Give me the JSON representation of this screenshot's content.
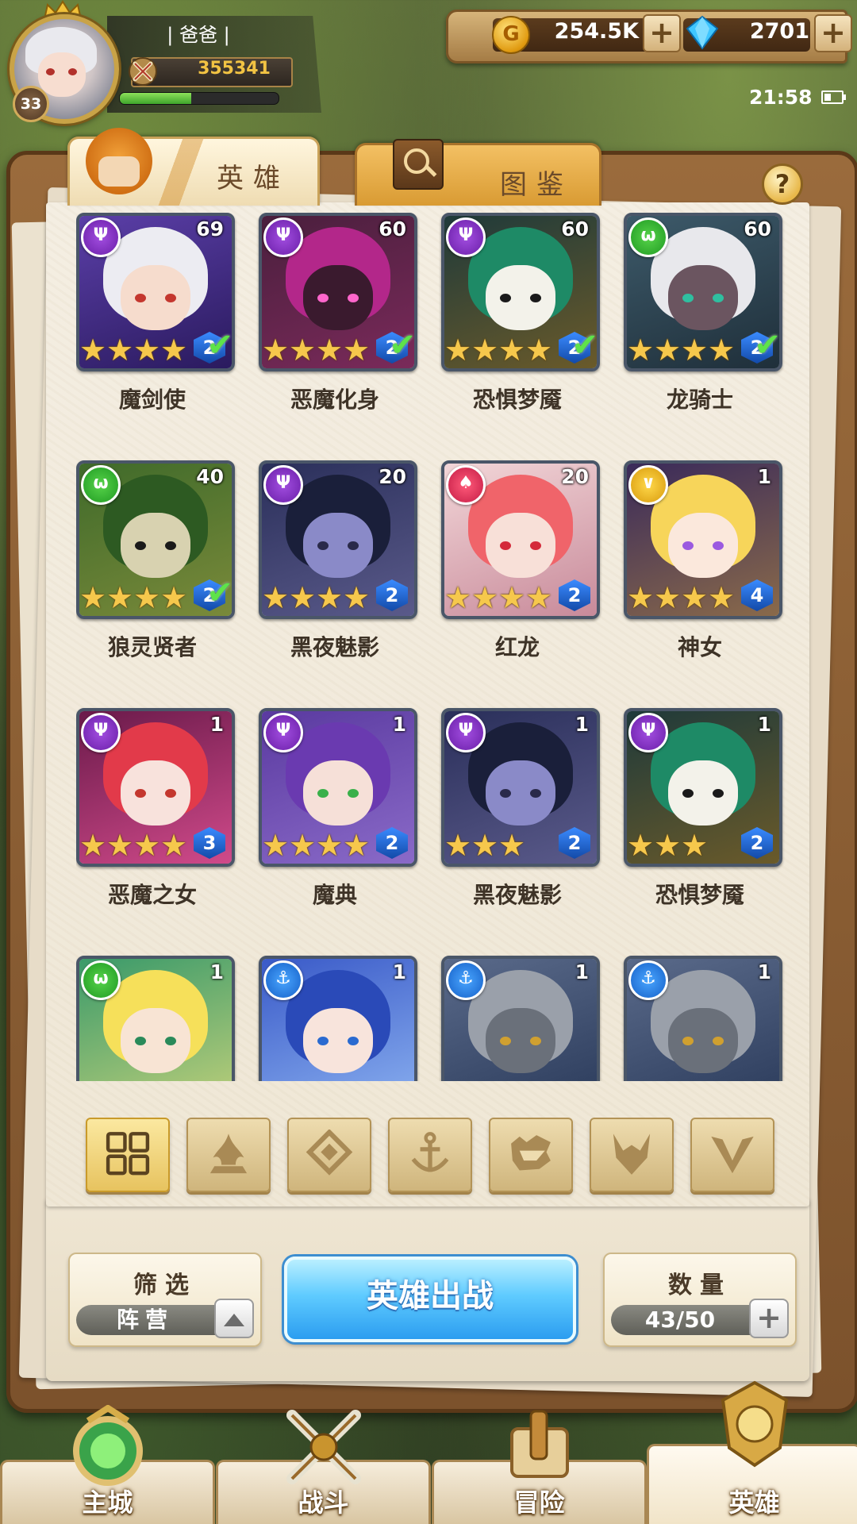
{
  "player": {
    "name": "| 爸爸 |",
    "level": "33",
    "power": "355341",
    "exp_fraction": 0.45
  },
  "resources": {
    "gold": "254.5K",
    "gems": "2701"
  },
  "status": {
    "time": "21:58"
  },
  "tabs": {
    "heroes": "英雄",
    "codex": "图鉴"
  },
  "heroes": [
    {
      "name": "魔剑使",
      "level": "69",
      "faction": "demon",
      "stars": 4,
      "rank": "2",
      "ready": true
    },
    {
      "name": "恶魔化身",
      "level": "60",
      "faction": "demon",
      "stars": 4,
      "rank": "2",
      "ready": true
    },
    {
      "name": "恐惧梦魇",
      "level": "60",
      "faction": "demon",
      "stars": 4,
      "rank": "2",
      "ready": true
    },
    {
      "name": "龙骑士",
      "level": "60",
      "faction": "beast",
      "stars": 4,
      "rank": "2",
      "ready": true
    },
    {
      "name": "狼灵贤者",
      "level": "40",
      "faction": "beast",
      "stars": 4,
      "rank": "2",
      "ready": true
    },
    {
      "name": "黑夜魅影",
      "level": "20",
      "faction": "demon",
      "stars": 4,
      "rank": "2",
      "ready": false
    },
    {
      "name": "红龙",
      "level": "20",
      "faction": "fire",
      "stars": 4,
      "rank": "2",
      "ready": false
    },
    {
      "name": "神女",
      "level": "1",
      "faction": "holy",
      "stars": 4,
      "rank": "4",
      "ready": false
    },
    {
      "name": "恶魔之女",
      "level": "1",
      "faction": "demon",
      "stars": 4,
      "rank": "3",
      "ready": false
    },
    {
      "name": "魔典",
      "level": "1",
      "faction": "demon",
      "stars": 4,
      "rank": "2",
      "ready": false
    },
    {
      "name": "黑夜魅影",
      "level": "1",
      "faction": "demon",
      "stars": 3,
      "rank": "2",
      "ready": false
    },
    {
      "name": "恐惧梦魇",
      "level": "1",
      "faction": "demon",
      "stars": 3,
      "rank": "2",
      "ready": false
    },
    {
      "name": "",
      "level": "1",
      "faction": "beast",
      "stars": 0,
      "rank": "",
      "ready": false
    },
    {
      "name": "",
      "level": "1",
      "faction": "sea",
      "stars": 0,
      "rank": "",
      "ready": false
    },
    {
      "name": "",
      "level": "1",
      "faction": "sea",
      "stars": 0,
      "rank": "",
      "ready": false
    },
    {
      "name": "",
      "level": "1",
      "faction": "sea",
      "stars": 0,
      "rank": "",
      "ready": false
    }
  ],
  "filters": [
    {
      "id": "all",
      "icon": "grid-icon",
      "active": true
    },
    {
      "id": "fire",
      "icon": "flame-icon",
      "active": false
    },
    {
      "id": "holy",
      "icon": "diamond-icon",
      "active": false
    },
    {
      "id": "sea",
      "icon": "anchor-icon",
      "active": false
    },
    {
      "id": "beast",
      "icon": "wolf-icon",
      "active": false
    },
    {
      "id": "demon",
      "icon": "demon-horns-icon",
      "active": false
    },
    {
      "id": "holy-wing",
      "icon": "chevron-wing-icon",
      "active": false
    }
  ],
  "filter_panel": {
    "title": "筛选",
    "value": "阵营"
  },
  "deploy": {
    "label": "英雄出战"
  },
  "count_panel": {
    "title": "数量",
    "value": "43/50"
  },
  "nav": [
    {
      "label": "主城",
      "active": false
    },
    {
      "label": "战斗",
      "active": false
    },
    {
      "label": "冒险",
      "active": false
    },
    {
      "label": "英雄",
      "active": true
    }
  ],
  "colors": {
    "gold_text": "#f2c343",
    "deploy_blue": "#2b9df0",
    "demon": "#6a1ea8",
    "beast": "#1f9a22",
    "fire": "#c41c45",
    "holy": "#d89a0c",
    "sea": "#1560c8"
  }
}
